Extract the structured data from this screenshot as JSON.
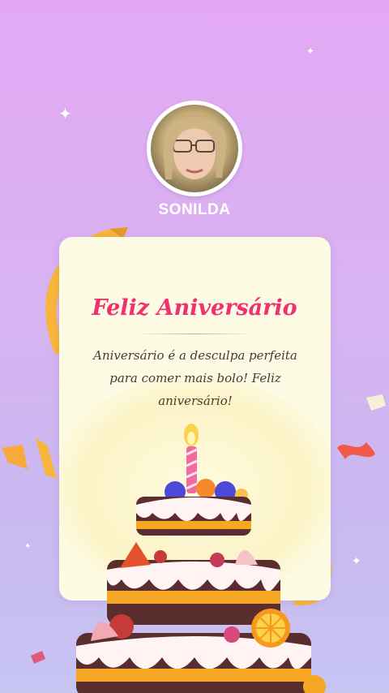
{
  "profile": {
    "name": "SONILDA"
  },
  "card": {
    "title": "Feliz Aniversário",
    "message": "Aniversário é a desculpa perfeita para comer mais bolo! Feliz aniversário!"
  },
  "colors": {
    "title": "#f0306f",
    "card_background": "#fdfbe3",
    "background_top": "#e3a8f5",
    "background_bottom": "#c7c4f2"
  },
  "icons": [
    "sparkle-icon",
    "ribbon-icon",
    "confetti-icon",
    "candle-icon",
    "cake-icon"
  ]
}
